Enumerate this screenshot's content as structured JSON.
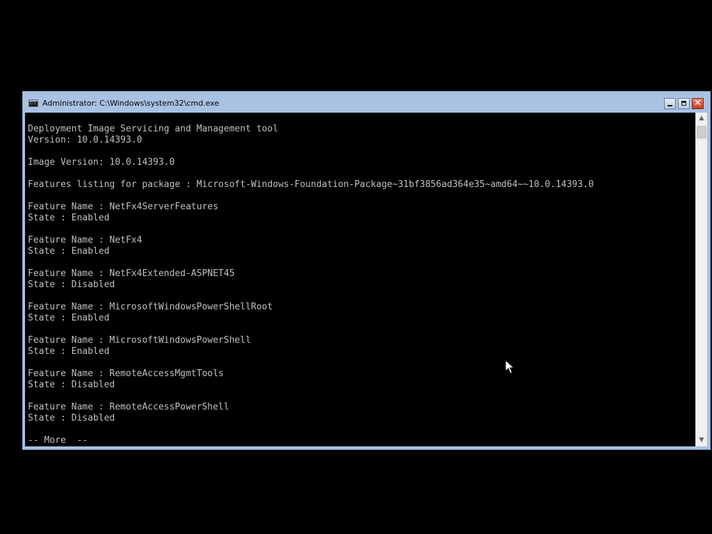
{
  "window": {
    "title": "Administrator: C:\\Windows\\system32\\cmd.exe",
    "icon": "cmd-console-icon",
    "controls": {
      "minimize": "minimize-icon",
      "maximize": "maximize-icon",
      "close": "close-icon",
      "close_glyph": "✕"
    }
  },
  "console": {
    "text_color": "#c0c0c0",
    "background_color": "#000000",
    "lines": [
      "Deployment Image Servicing and Management tool",
      "Version: 10.0.14393.0",
      "",
      "Image Version: 10.0.14393.0",
      "",
      "Features listing for package : Microsoft-Windows-Foundation-Package~31bf3856ad364e35~amd64~~10.0.14393.0",
      "",
      "Feature Name : NetFx4ServerFeatures",
      "State : Enabled",
      "",
      "Feature Name : NetFx4",
      "State : Enabled",
      "",
      "Feature Name : NetFx4Extended-ASPNET45",
      "State : Disabled",
      "",
      "Feature Name : MicrosoftWindowsPowerShellRoot",
      "State : Enabled",
      "",
      "Feature Name : MicrosoftWindowsPowerShell",
      "State : Enabled",
      "",
      "Feature Name : RemoteAccessMgmtTools",
      "State : Disabled",
      "",
      "Feature Name : RemoteAccessPowerShell",
      "State : Disabled",
      "",
      "-- More  --"
    ]
  },
  "scrollbar": {
    "up_arrow": "▲",
    "down_arrow": "▼"
  },
  "colors": {
    "titlebar": "#a9c2e3",
    "close_button": "#c23c1e",
    "desktop": "#000000"
  }
}
